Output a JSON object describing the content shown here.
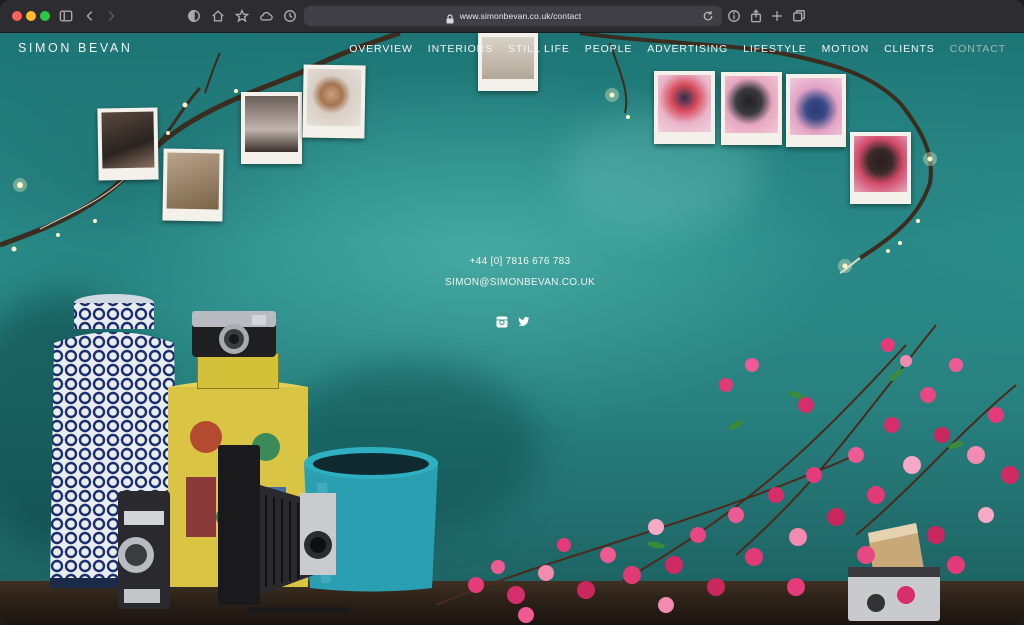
{
  "browser": {
    "url": "www.simonbevan.co.uk/contact"
  },
  "site": {
    "logo": "SIMON BEVAN",
    "nav": [
      {
        "label": "OVERVIEW",
        "active": false
      },
      {
        "label": "INTERIORS",
        "active": false
      },
      {
        "label": "STILL LIFE",
        "active": false
      },
      {
        "label": "PEOPLE",
        "active": false
      },
      {
        "label": "ADVERTISING",
        "active": false
      },
      {
        "label": "LIFESTYLE",
        "active": false
      },
      {
        "label": "MOTION",
        "active": false
      },
      {
        "label": "CLIENTS",
        "active": false
      },
      {
        "label": "CONTACT",
        "active": true
      }
    ]
  },
  "contact": {
    "phone": "+44 [0] 7816 676 783",
    "email": "SIMON@SIMONBEVAN.CO.UK"
  },
  "social": [
    "instagram-icon",
    "twitter-icon"
  ],
  "colors": {
    "wall": "#2a8f8b",
    "toolbar": "#2d2c31",
    "nav_active": "#a6b5b4"
  }
}
